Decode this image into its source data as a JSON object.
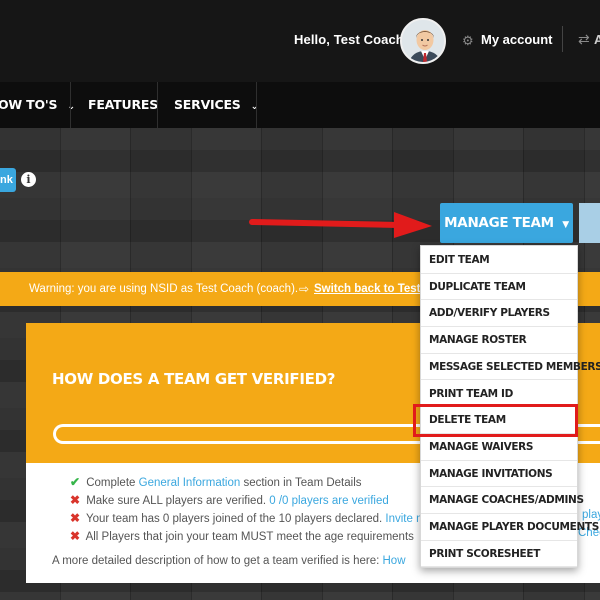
{
  "header": {
    "greeting": "Hello, Test Coach",
    "my_account": "My account",
    "swap_label": "A"
  },
  "nav": {
    "items": [
      {
        "label": "OW TO'S",
        "has_caret": true
      },
      {
        "label": "FEATURES",
        "has_caret": false
      },
      {
        "label": "SERVICES",
        "has_caret": true
      }
    ]
  },
  "toolbar": {
    "left_button_label": "nk",
    "manage_team_label": "MANAGE TEAM"
  },
  "warning": {
    "text": "Warning: you are using NSID as Test Coach (coach).",
    "switch_link": "Switch back to Test"
  },
  "panel": {
    "title": "HOW DOES A TEAM GET VERIFIED?",
    "progress_fraction": 0,
    "checklist": [
      {
        "status": "ok",
        "before": "Complete ",
        "link": "General Information",
        "after": " section in Team Details"
      },
      {
        "status": "bad",
        "before": "Make sure ALL players are verified. ",
        "link": "0 /0 players are verified",
        "after": ""
      },
      {
        "status": "bad",
        "before": "Your team has 0 players joined of the 10 players declared. ",
        "link": "Invite m",
        "after": ""
      },
      {
        "status": "bad",
        "before": "All Players that join your team MUST meet the age requirements",
        "link": "",
        "after": ""
      }
    ],
    "clipped_right": [
      {
        "text": "play"
      },
      {
        "text": "Chec"
      }
    ],
    "description": "A more detailed description of how to get a team verified is here: ",
    "description_link": "How"
  },
  "dropdown": {
    "items": [
      "EDIT TEAM",
      "DUPLICATE TEAM",
      "ADD/VERIFY PLAYERS",
      "MANAGE ROSTER",
      "MESSAGE SELECTED MEMBERS",
      "PRINT TEAM ID",
      "DELETE TEAM",
      "MANAGE WAIVERS",
      "MANAGE INVITATIONS",
      "MANAGE COACHES/ADMINS",
      "MANAGE PLAYER DOCUMENTS",
      "PRINT SCORESHEET"
    ],
    "highlighted_item": "DELETE TEAM"
  },
  "colors": {
    "accent_blue": "#3aa7df",
    "warning_orange": "#f4a916",
    "highlight_red": "#e11b1b",
    "ok_green": "#36b54a",
    "bad_red": "#d9342b"
  },
  "icons": {
    "avatar": "avatar-icon",
    "gear": "gear-icon",
    "swap": "swap-icon",
    "info": "info-icon",
    "switch": "switch-user-icon",
    "arrow": "red-arrow-annotation"
  }
}
